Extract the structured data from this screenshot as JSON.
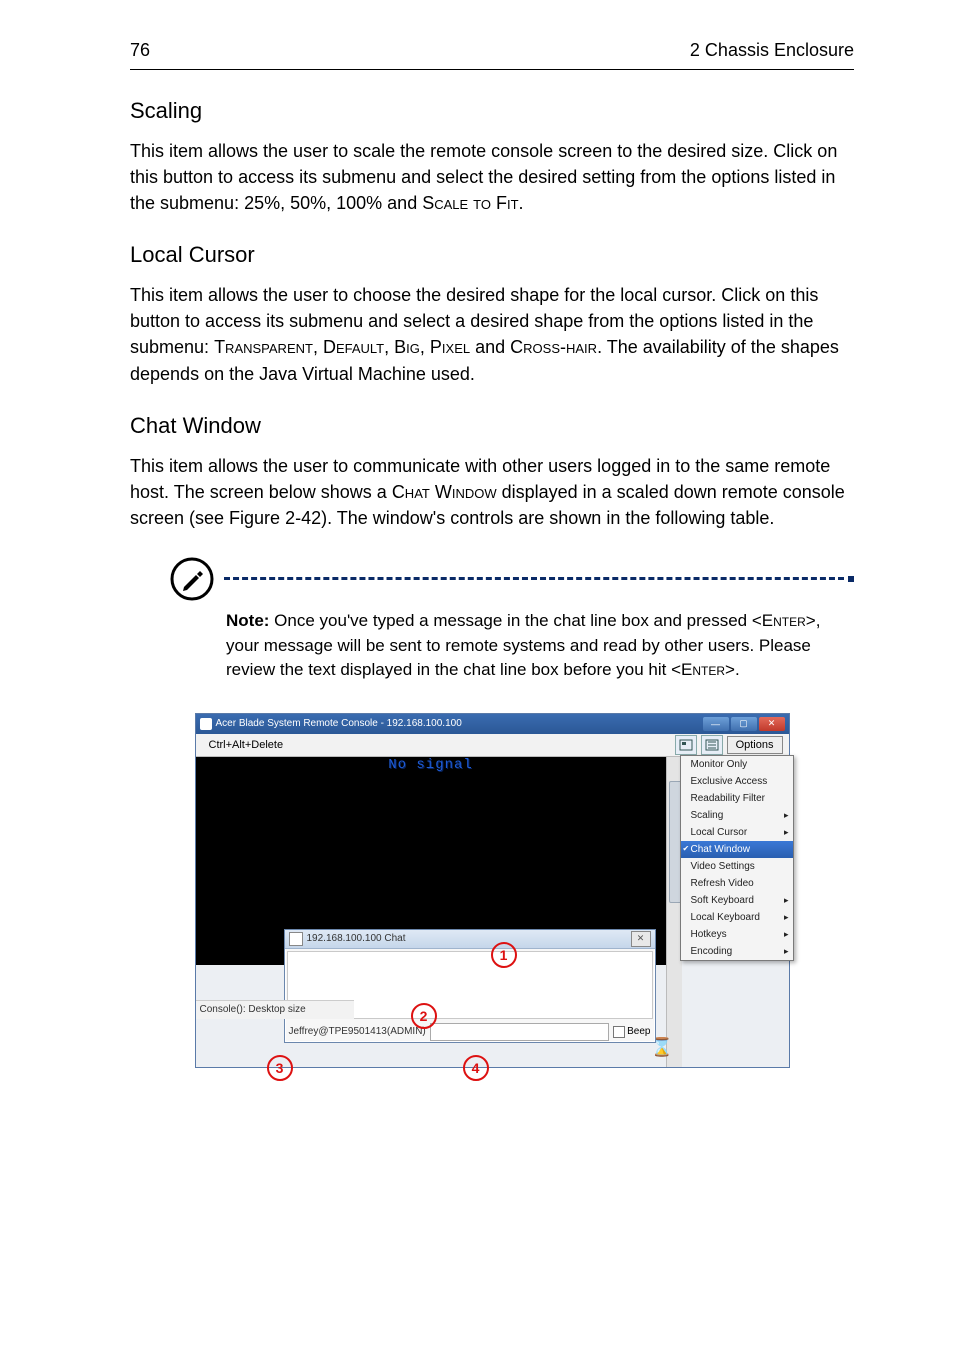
{
  "header": {
    "page_number": "76",
    "chapter_title": "2 Chassis Enclosure"
  },
  "sections": {
    "scaling": {
      "heading": "Scaling",
      "body_pre": "This item allows the user to scale the remote console screen to the desired size. Click on this button to access its submenu and select the desired setting from the options listed in the submenu: 25%, 50%, 100% and ",
      "body_sc": "Scale to Fit",
      "body_post": "."
    },
    "local_cursor": {
      "heading": "Local Cursor",
      "body_pre": "This item allows the user to choose the desired shape for the local cursor. Click on this button to access its submenu and select a desired shape from the options listed in the submenu: ",
      "sc1": "Transparent",
      "sep1": ", ",
      "sc2": "Default",
      "sep2": ", ",
      "sc3": "Big",
      "sep3": ", ",
      "sc4": "Pixel",
      "sep4": " and ",
      "sc5": "Cross-hair",
      "body_post": ". The availability of the shapes depends on the Java Virtual Machine used."
    },
    "chat_window": {
      "heading": "Chat Window",
      "body_pre": "This item allows the user to communicate with other users logged in to the same remote host. The screen below shows a ",
      "sc1": "Chat Window",
      "body_post": " displayed in a scaled down remote console screen (see Figure 2-42). The window's controls are shown in the following table."
    }
  },
  "note": {
    "label": "Note:",
    "text_pre": " Once you've typed a message in the chat line box and pressed <",
    "sc1": "Enter",
    "text_mid": ">, your message will be sent to remote systems and read by other users. Please review the text displayed in the chat line box before you hit <",
    "sc2": "Enter",
    "text_post": ">."
  },
  "screenshot": {
    "window_title": "Acer Blade System Remote Console - 192.168.100.100",
    "menu_left": "Ctrl+Alt+Delete",
    "options_button": "Options",
    "no_signal": "No signal",
    "status_text": "Console(): Desktop size",
    "dropdown_items": [
      {
        "label": "Monitor Only",
        "arrow": false,
        "selected": false
      },
      {
        "label": "Exclusive Access",
        "arrow": false,
        "selected": false
      },
      {
        "label": "Readability Filter",
        "arrow": false,
        "selected": false
      },
      {
        "label": "Scaling",
        "arrow": true,
        "selected": false
      },
      {
        "label": "Local Cursor",
        "arrow": true,
        "selected": false
      },
      {
        "label": "Chat Window",
        "arrow": false,
        "selected": true
      },
      {
        "label": "Video Settings",
        "arrow": false,
        "selected": false
      },
      {
        "label": "Refresh Video",
        "arrow": false,
        "selected": false
      },
      {
        "label": "Soft Keyboard",
        "arrow": true,
        "selected": false
      },
      {
        "label": "Local Keyboard",
        "arrow": true,
        "selected": false
      },
      {
        "label": "Hotkeys",
        "arrow": true,
        "selected": false
      },
      {
        "label": "Encoding",
        "arrow": true,
        "selected": false
      }
    ],
    "chat": {
      "title": "192.168.100.100 Chat",
      "user_label": "Jeffrey@TPE9501413(ADMIN)",
      "beep_label": "Beep"
    },
    "callouts": {
      "c1": "1",
      "c2": "2",
      "c3": "3",
      "c4": "4"
    }
  }
}
